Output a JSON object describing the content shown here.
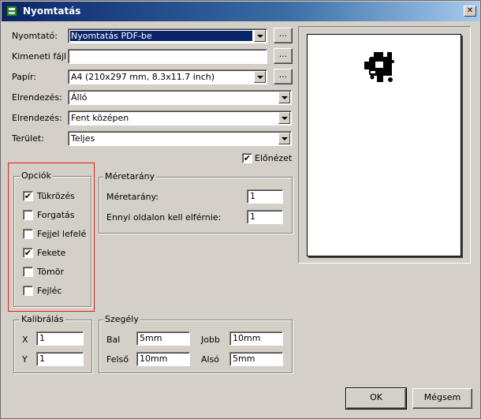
{
  "window": {
    "title": "Nyomtatás",
    "close_glyph": "✕"
  },
  "form": {
    "printer": {
      "label": "Nyomtató:",
      "value": "Nyomtatás PDF-be"
    },
    "output_file": {
      "label": "Kimeneti fájl",
      "value": ""
    },
    "paper": {
      "label": "Papír:",
      "value": "A4 (210x297 mm, 8.3x11.7 inch)"
    },
    "orientation": {
      "label": "Elrendezés:",
      "value": "Álló"
    },
    "layout": {
      "label": "Elrendezés:",
      "value": "Fent középen"
    },
    "area": {
      "label": "Terület:",
      "value": "Teljes"
    },
    "browse_label": "..."
  },
  "preview": {
    "label": "Előnézet",
    "checked": true
  },
  "options": {
    "legend": "Opciók",
    "items": [
      {
        "label": "Tükrözés",
        "checked": true
      },
      {
        "label": "Forgatás",
        "checked": false
      },
      {
        "label": "Fejjel lefelé",
        "checked": false
      },
      {
        "label": "Fekete",
        "checked": true
      },
      {
        "label": "Tömör",
        "checked": false
      },
      {
        "label": "Fejléc",
        "checked": false
      }
    ]
  },
  "scale": {
    "legend": "Méretarány",
    "ratio_label": "Méretarány:",
    "ratio_value": "1",
    "pages_label": "Ennyi oldalon kell elférnie:",
    "pages_value": "1"
  },
  "calibration": {
    "legend": "Kalibrálás",
    "x_label": "X",
    "x_value": "1",
    "y_label": "Y",
    "y_value": "1"
  },
  "margin": {
    "legend": "Szegély",
    "left_label": "Bal",
    "left_value": "5mm",
    "right_label": "Jobb",
    "right_value": "10mm",
    "top_label": "Felső",
    "top_value": "10mm",
    "bottom_label": "Alsó",
    "bottom_value": "5mm"
  },
  "buttons": {
    "ok": "OK",
    "cancel": "Mégsem"
  },
  "check_glyph": "✔",
  "colors": {
    "title_start": "#0a246a",
    "title_end": "#a6caf0",
    "selection": "#0a246a",
    "highlight_box": "#e02020",
    "face": "#d4d0c8"
  }
}
